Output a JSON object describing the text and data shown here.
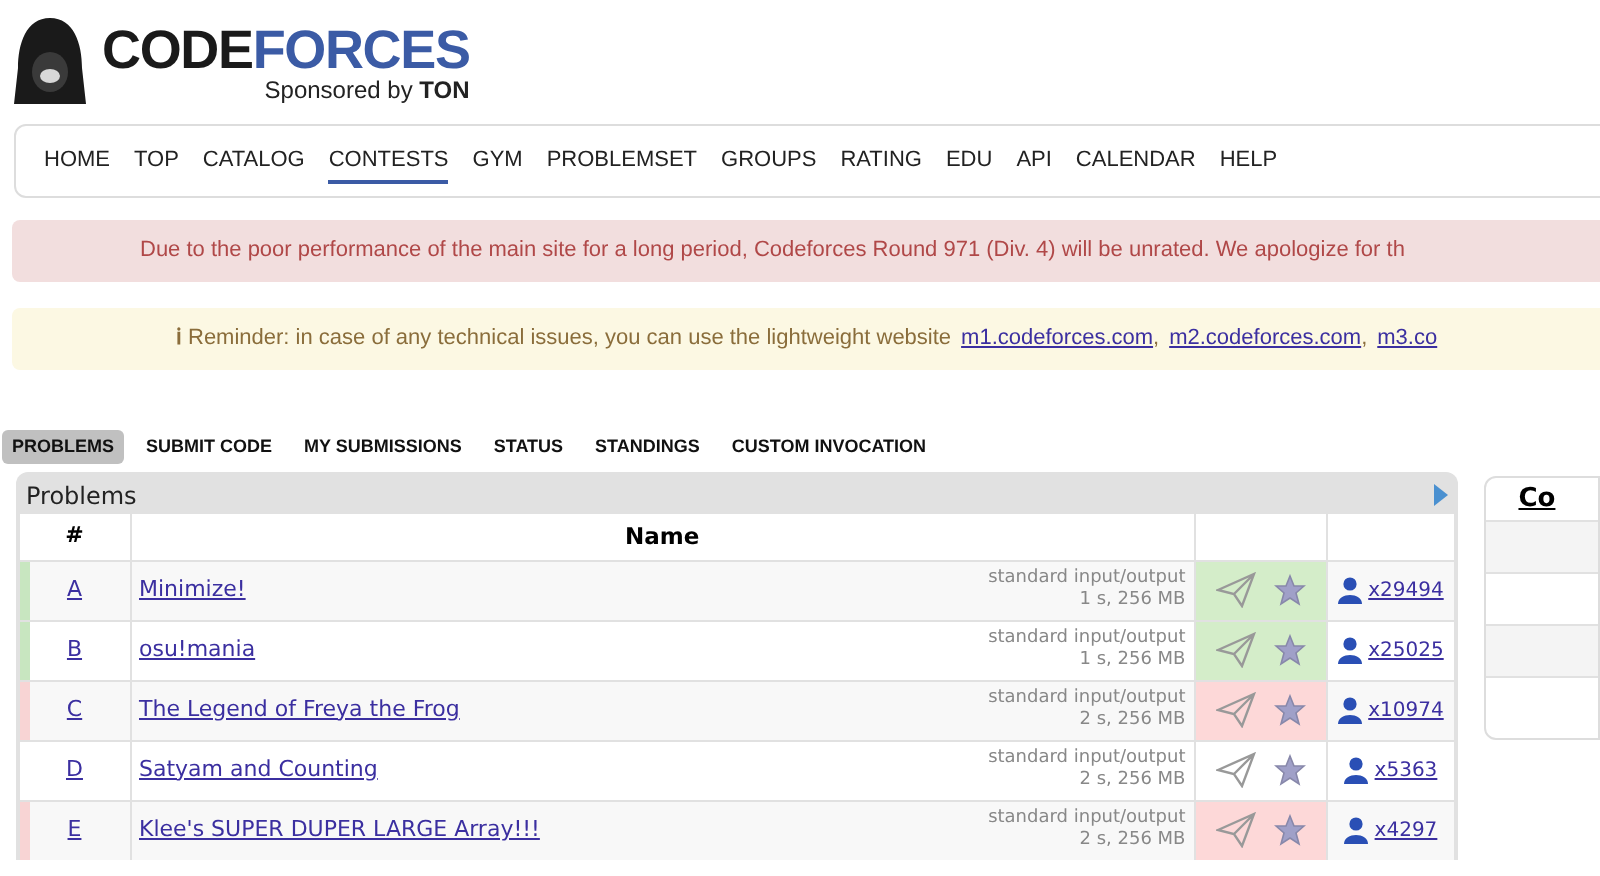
{
  "logo": {
    "first": "CODE",
    "second": "FORCES",
    "sponsor": "Sponsored by **TON**"
  },
  "nav": [
    {
      "label": "HOME",
      "selected": false
    },
    {
      "label": "TOP",
      "selected": false
    },
    {
      "label": "CATALOG",
      "selected": false
    },
    {
      "label": "CONTESTS",
      "selected": true
    },
    {
      "label": "GYM",
      "selected": false
    },
    {
      "label": "PROBLEMSET",
      "selected": false
    },
    {
      "label": "GROUPS",
      "selected": false
    },
    {
      "label": "RATING",
      "selected": false
    },
    {
      "label": "EDU",
      "selected": false
    },
    {
      "label": "API",
      "selected": false
    },
    {
      "label": "CALENDAR",
      "selected": false
    },
    {
      "label": "HELP",
      "selected": false
    }
  ],
  "alert": "Due to the poor performance of the main site for a long period, Codeforces Round 971 (Div. 4) will be unrated. We apologize for th",
  "reminder": {
    "icon": "ℹ",
    "text": "Reminder: in case of any technical issues, you can use the lightweight website",
    "links": [
      "m1.codeforces.com",
      "m2.codeforces.com",
      "m3.co"
    ],
    "separator": ","
  },
  "tabs": [
    {
      "label": "PROBLEMS",
      "selected": true
    },
    {
      "label": "SUBMIT CODE",
      "selected": false
    },
    {
      "label": "MY SUBMISSIONS",
      "selected": false
    },
    {
      "label": "STATUS",
      "selected": false
    },
    {
      "label": "STANDINGS",
      "selected": false
    },
    {
      "label": "CUSTOM INVOCATION",
      "selected": false
    }
  ],
  "problems": {
    "title": "Problems",
    "columns": [
      "#",
      "Name"
    ],
    "rows": [
      {
        "index": "A",
        "name": "Minimize!",
        "io": "standard input/output",
        "limits": "1 s, 256 MB",
        "accepted": true,
        "rejected": false,
        "solved": "x29494"
      },
      {
        "index": "B",
        "name": "osu!mania",
        "io": "standard input/output",
        "limits": "1 s, 256 MB",
        "accepted": true,
        "rejected": false,
        "solved": "x25025"
      },
      {
        "index": "C",
        "name": "The Legend of Freya the Frog",
        "io": "standard input/output",
        "limits": "2 s, 256 MB",
        "accepted": false,
        "rejected": true,
        "solved": "x10974"
      },
      {
        "index": "D",
        "name": "Satyam and Counting",
        "io": "standard input/output",
        "limits": "2 s, 256 MB",
        "accepted": false,
        "rejected": false,
        "solved": "x5363"
      },
      {
        "index": "E",
        "name": "Klee's SUPER DUPER LARGE Array!!!",
        "io": "standard input/output",
        "limits": "2 s, 256 MB",
        "accepted": false,
        "rejected": true,
        "solved": "x4297"
      }
    ]
  },
  "side_box": {
    "heading": "Co"
  }
}
